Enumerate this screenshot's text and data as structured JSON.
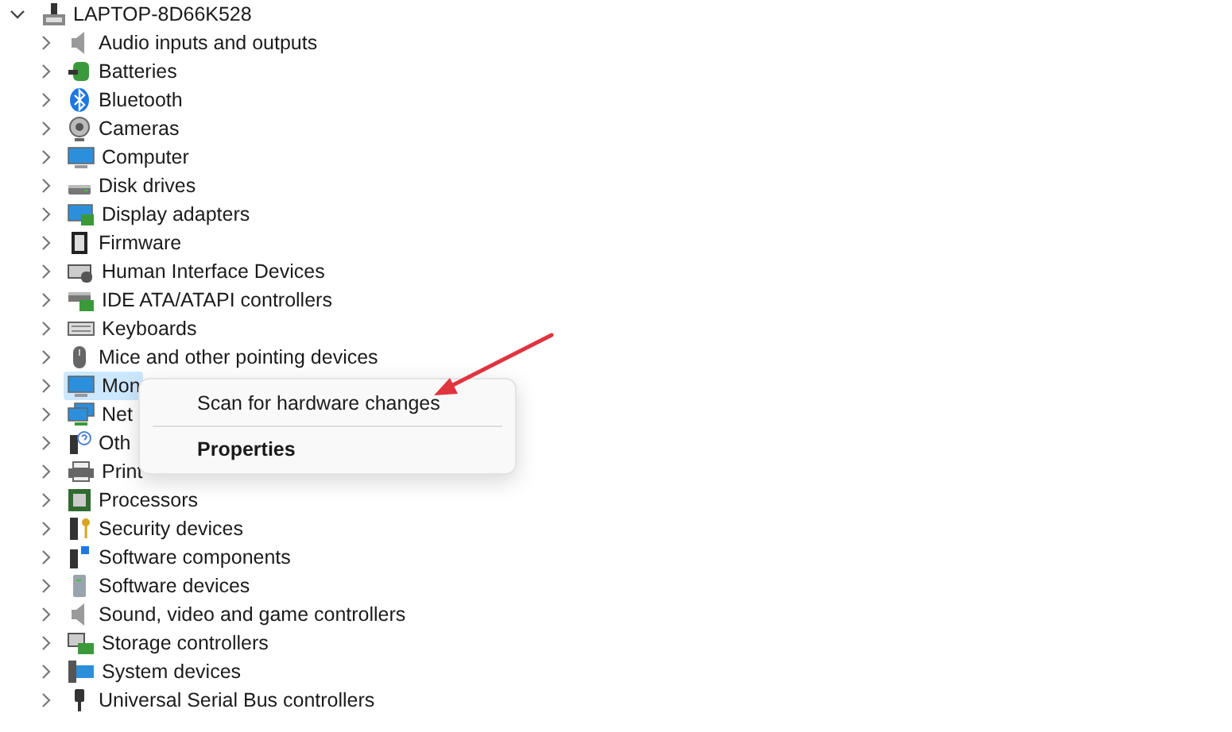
{
  "tree": {
    "root": {
      "label": "LAPTOP-8D66K528",
      "expanded": true,
      "selected": false,
      "children": [
        {
          "label": "Audio inputs and outputs",
          "expanded": false,
          "selected": false
        },
        {
          "label": "Batteries",
          "expanded": false,
          "selected": false
        },
        {
          "label": "Bluetooth",
          "expanded": false,
          "selected": false
        },
        {
          "label": "Cameras",
          "expanded": false,
          "selected": false
        },
        {
          "label": "Computer",
          "expanded": false,
          "selected": false
        },
        {
          "label": "Disk drives",
          "expanded": false,
          "selected": false
        },
        {
          "label": "Display adapters",
          "expanded": false,
          "selected": false
        },
        {
          "label": "Firmware",
          "expanded": false,
          "selected": false
        },
        {
          "label": "Human Interface Devices",
          "expanded": false,
          "selected": false
        },
        {
          "label": "IDE ATA/ATAPI controllers",
          "expanded": false,
          "selected": false
        },
        {
          "label": "Keyboards",
          "expanded": false,
          "selected": false
        },
        {
          "label": "Mice and other pointing devices",
          "expanded": false,
          "selected": false
        },
        {
          "label": "Mon",
          "expanded": false,
          "selected": true
        },
        {
          "label": "Net",
          "expanded": false,
          "selected": false
        },
        {
          "label": "Oth",
          "expanded": false,
          "selected": false
        },
        {
          "label": "Print",
          "expanded": false,
          "selected": false
        },
        {
          "label": "Processors",
          "expanded": false,
          "selected": false
        },
        {
          "label": "Security devices",
          "expanded": false,
          "selected": false
        },
        {
          "label": "Software components",
          "expanded": false,
          "selected": false
        },
        {
          "label": "Software devices",
          "expanded": false,
          "selected": false
        },
        {
          "label": "Sound, video and game controllers",
          "expanded": false,
          "selected": false
        },
        {
          "label": "Storage controllers",
          "expanded": false,
          "selected": false
        },
        {
          "label": "System devices",
          "expanded": false,
          "selected": false
        },
        {
          "label": "Universal Serial Bus controllers",
          "expanded": false,
          "selected": false
        }
      ]
    }
  },
  "context_menu": {
    "items": [
      {
        "kind": "command",
        "label": "Scan for hardware changes"
      },
      {
        "kind": "separator"
      },
      {
        "kind": "default",
        "label": "Properties"
      }
    ]
  }
}
